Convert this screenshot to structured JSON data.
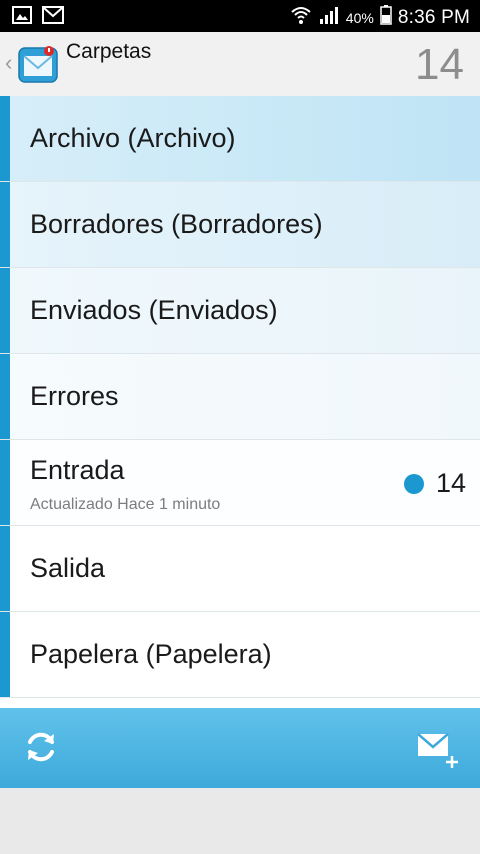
{
  "status_bar": {
    "battery_percent": "40%",
    "time": "8:36 PM"
  },
  "header": {
    "title": "Carpetas",
    "count": "14"
  },
  "folders": [
    {
      "label": "Archivo (Archivo)",
      "subtitle": "",
      "unread": ""
    },
    {
      "label": "Borradores (Borradores)",
      "subtitle": "",
      "unread": ""
    },
    {
      "label": "Enviados (Enviados)",
      "subtitle": "",
      "unread": ""
    },
    {
      "label": "Errores",
      "subtitle": "",
      "unread": ""
    },
    {
      "label": "Entrada",
      "subtitle": "Actualizado Hace 1 minuto",
      "unread": "14"
    },
    {
      "label": "Salida",
      "subtitle": "",
      "unread": ""
    },
    {
      "label": "Papelera (Papelera)",
      "subtitle": "",
      "unread": ""
    }
  ],
  "toolbar": {
    "left_icon": "refresh-icon",
    "right_icon": "compose-mail-icon"
  },
  "colors": {
    "accent": "#1b98cf",
    "toolbar": "#3ea9db"
  }
}
